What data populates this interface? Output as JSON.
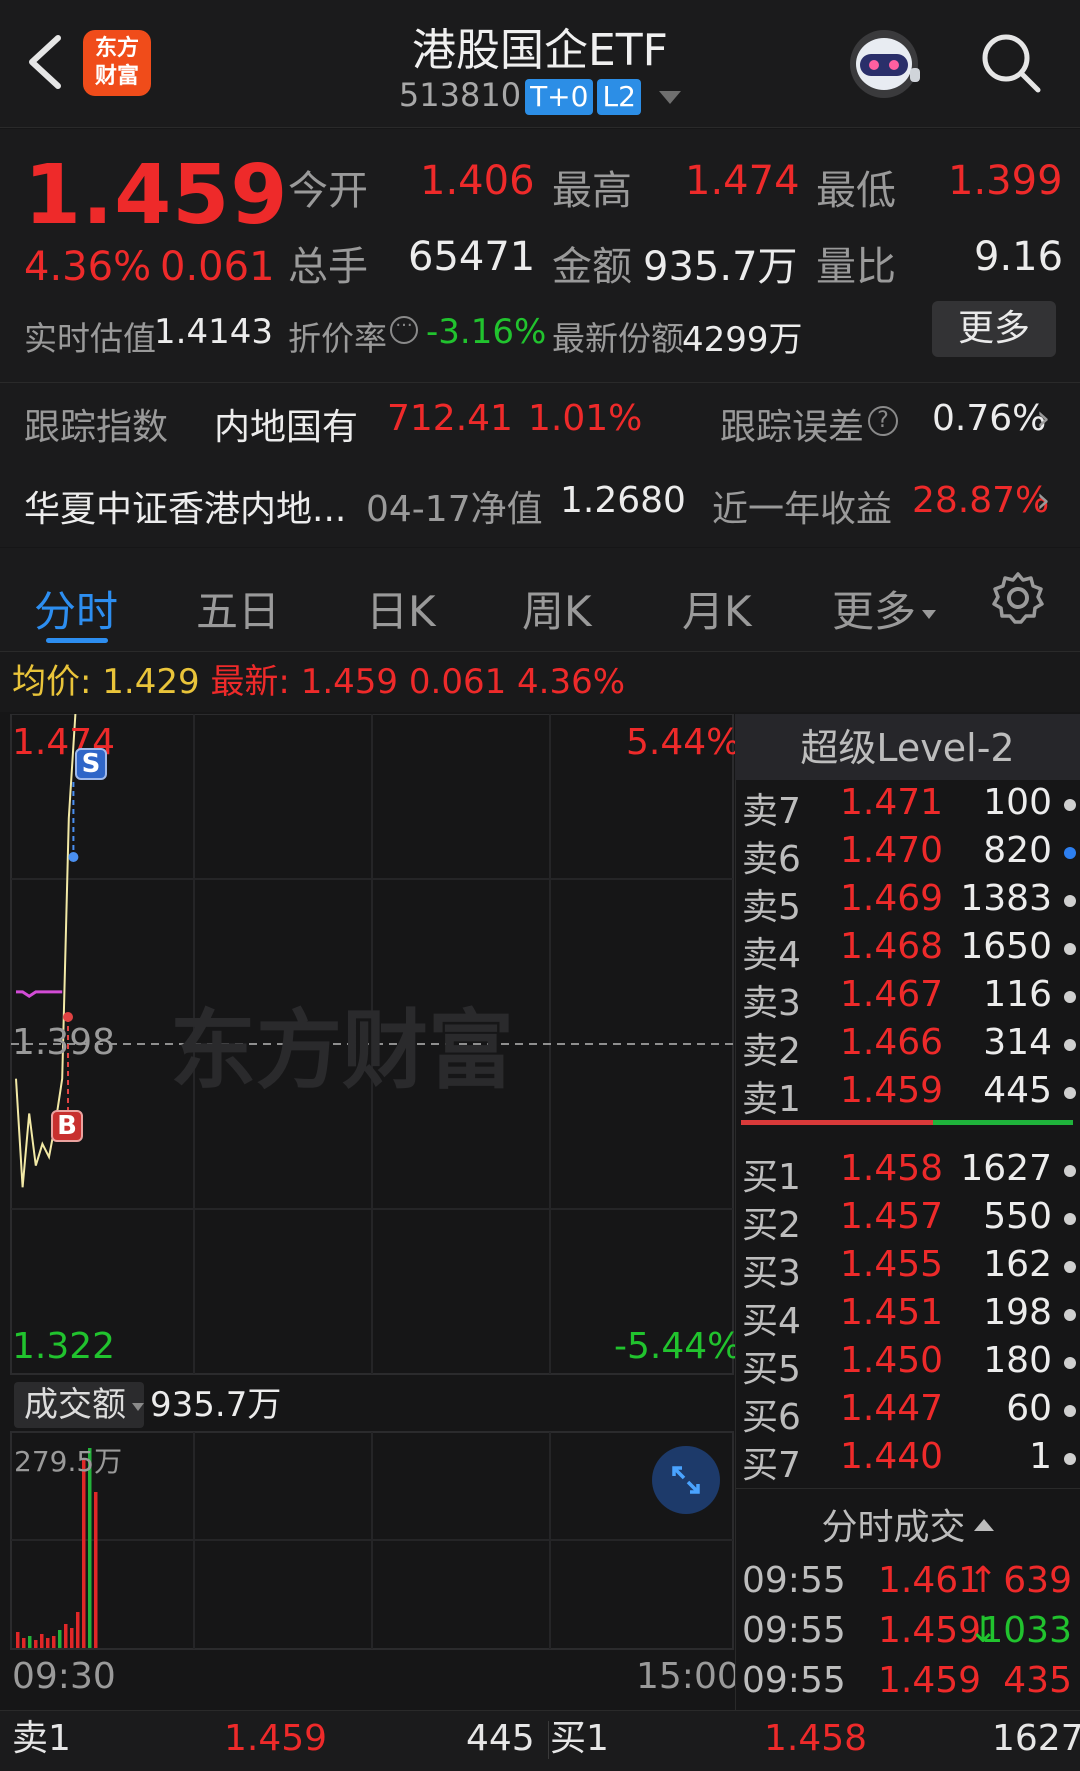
{
  "header": {
    "title": "港股国企ETF",
    "code": "513810",
    "tag_t0": "T+0",
    "tag_l2": "L2",
    "logo_line1": "东方",
    "logo_line2": "财富",
    "icons": [
      "back-chevron-icon",
      "robot-avatar-icon",
      "search-icon"
    ]
  },
  "quote": {
    "price": "1.459",
    "change_pct": "4.36%",
    "change_abs": "0.061",
    "open_label": "今开",
    "open": "1.406",
    "high_label": "最高",
    "high": "1.474",
    "low_label": "最低",
    "low": "1.399",
    "volume_label": "总手",
    "volume": "65471",
    "amount_label": "金额",
    "amount": "935.7万",
    "ratio_label": "量比",
    "ratio": "9.16",
    "iopv_label": "实时估值",
    "iopv": "1.4143",
    "discount_label": "折价率",
    "discount": "-3.16%",
    "shares_label": "最新份额",
    "shares": "4299万",
    "more_button": "更多"
  },
  "index_row": {
    "label": "跟踪指数",
    "index_name": "内地国有",
    "index_value": "712.41",
    "index_change": "1.01%",
    "error_label": "跟踪误差",
    "error_value": "0.76%"
  },
  "fund_row": {
    "fund_name": "华夏中证香港内地...",
    "nav_label": "04-17净值",
    "nav": "1.2680",
    "return_label": "近一年收益",
    "return_value": "28.87%"
  },
  "tabs": [
    "分时",
    "五日",
    "日K",
    "周K",
    "月K",
    "更多"
  ],
  "avg_bar": {
    "avg_label": "均价:",
    "avg": "1.429",
    "latest_label": "最新:",
    "latest": "1.459",
    "latest_change": "0.061",
    "latest_pct": "4.36%"
  },
  "chart_data": {
    "type": "line",
    "y_top": "1.474",
    "y_bottom": "1.322",
    "pct_top": "5.44%",
    "pct_bottom": "-5.44%",
    "prev_close": "1.398",
    "time_start": "09:30",
    "time_end": "15:00",
    "watermark": "东方财富",
    "markers": [
      {
        "label": "S"
      },
      {
        "label": "B"
      }
    ],
    "volume_label": "成交额",
    "volume_value": "935.7万",
    "volume_max": "279.5万",
    "series": [
      {
        "values": [
          1.39,
          1.365,
          1.382,
          1.37,
          1.375,
          1.372,
          1.38,
          1.39,
          1.45,
          1.474
        ]
      },
      {
        "values": [
          1.41,
          1.41,
          1.409,
          1.41,
          1.41,
          1.41,
          1.41,
          1.41
        ]
      }
    ]
  },
  "level2": {
    "title": "超级Level-2",
    "asks": [
      {
        "label": "卖7",
        "price": "1.471",
        "vol": "100"
      },
      {
        "label": "卖6",
        "price": "1.470",
        "vol": "820"
      },
      {
        "label": "卖5",
        "price": "1.469",
        "vol": "1383"
      },
      {
        "label": "卖4",
        "price": "1.468",
        "vol": "1650"
      },
      {
        "label": "卖3",
        "price": "1.467",
        "vol": "116"
      },
      {
        "label": "卖2",
        "price": "1.466",
        "vol": "314"
      },
      {
        "label": "卖1",
        "price": "1.459",
        "vol": "445"
      }
    ],
    "bids": [
      {
        "label": "买1",
        "price": "1.458",
        "vol": "1627"
      },
      {
        "label": "买2",
        "price": "1.457",
        "vol": "550"
      },
      {
        "label": "买3",
        "price": "1.455",
        "vol": "162"
      },
      {
        "label": "买4",
        "price": "1.451",
        "vol": "198"
      },
      {
        "label": "买5",
        "price": "1.450",
        "vol": "180"
      },
      {
        "label": "买6",
        "price": "1.447",
        "vol": "60"
      },
      {
        "label": "买7",
        "price": "1.440",
        "vol": "1"
      }
    ],
    "trades_title": "分时成交",
    "trades": [
      {
        "time": "09:55",
        "price": "1.461",
        "dir": "↑",
        "vol": "639"
      },
      {
        "time": "09:55",
        "price": "1.459",
        "dir": "↓",
        "vol": "1033"
      },
      {
        "time": "09:55",
        "price": "1.459",
        "dir": "",
        "vol": "435"
      }
    ]
  },
  "bottom": {
    "sell_label": "卖1",
    "sell_price": "1.459",
    "sell_vol": "445",
    "buy_label": "买1",
    "buy_price": "1.458",
    "buy_vol": "1627"
  }
}
